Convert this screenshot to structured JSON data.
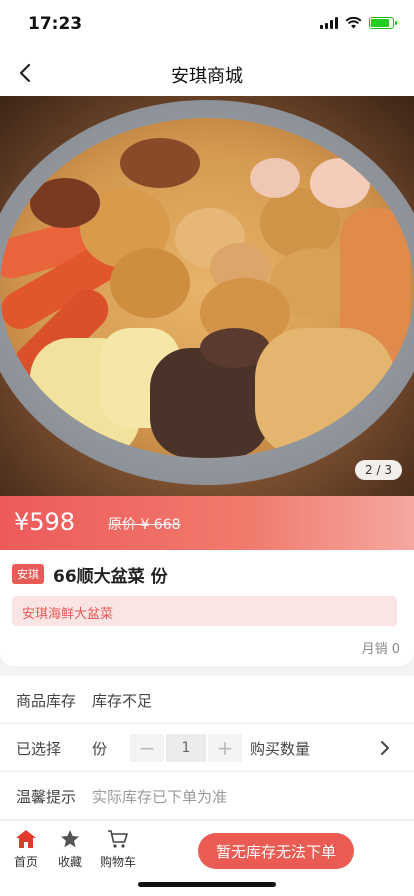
{
  "status_bar": {
    "time": "17:23"
  },
  "nav": {
    "title": "安琪商城"
  },
  "gallery": {
    "indicator": "2 / 3"
  },
  "price": {
    "current": "¥598",
    "original": "原价 ¥ 668"
  },
  "product": {
    "shop_tag": "安琪",
    "title": "66顺大盆菜 份",
    "description": "安琪海鲜大盆菜",
    "monthly_sales": "月销 0"
  },
  "details": {
    "stock": {
      "label": "商品库存",
      "value": "库存不足"
    },
    "selected": {
      "label": "已选择",
      "value": "份",
      "decrement": "−",
      "quantity": "1",
      "increment": "+",
      "quantity_label": "购买数量"
    },
    "tip": {
      "label": "温馨提示",
      "value": "实际库存已下单为准"
    }
  },
  "tabbar": {
    "home": "首页",
    "favorites": "收藏",
    "cart": "购物车",
    "cta": "暂无库存无法下单"
  },
  "colors": {
    "accent": "#e95b53",
    "tag": "#e85a55",
    "desc_bg": "#fbe4e4"
  },
  "icons": [
    "back-arrow-icon",
    "signal-icon",
    "wifi-icon",
    "battery-icon",
    "home-icon",
    "star-icon",
    "cart-icon",
    "chevron-right-icon"
  ]
}
